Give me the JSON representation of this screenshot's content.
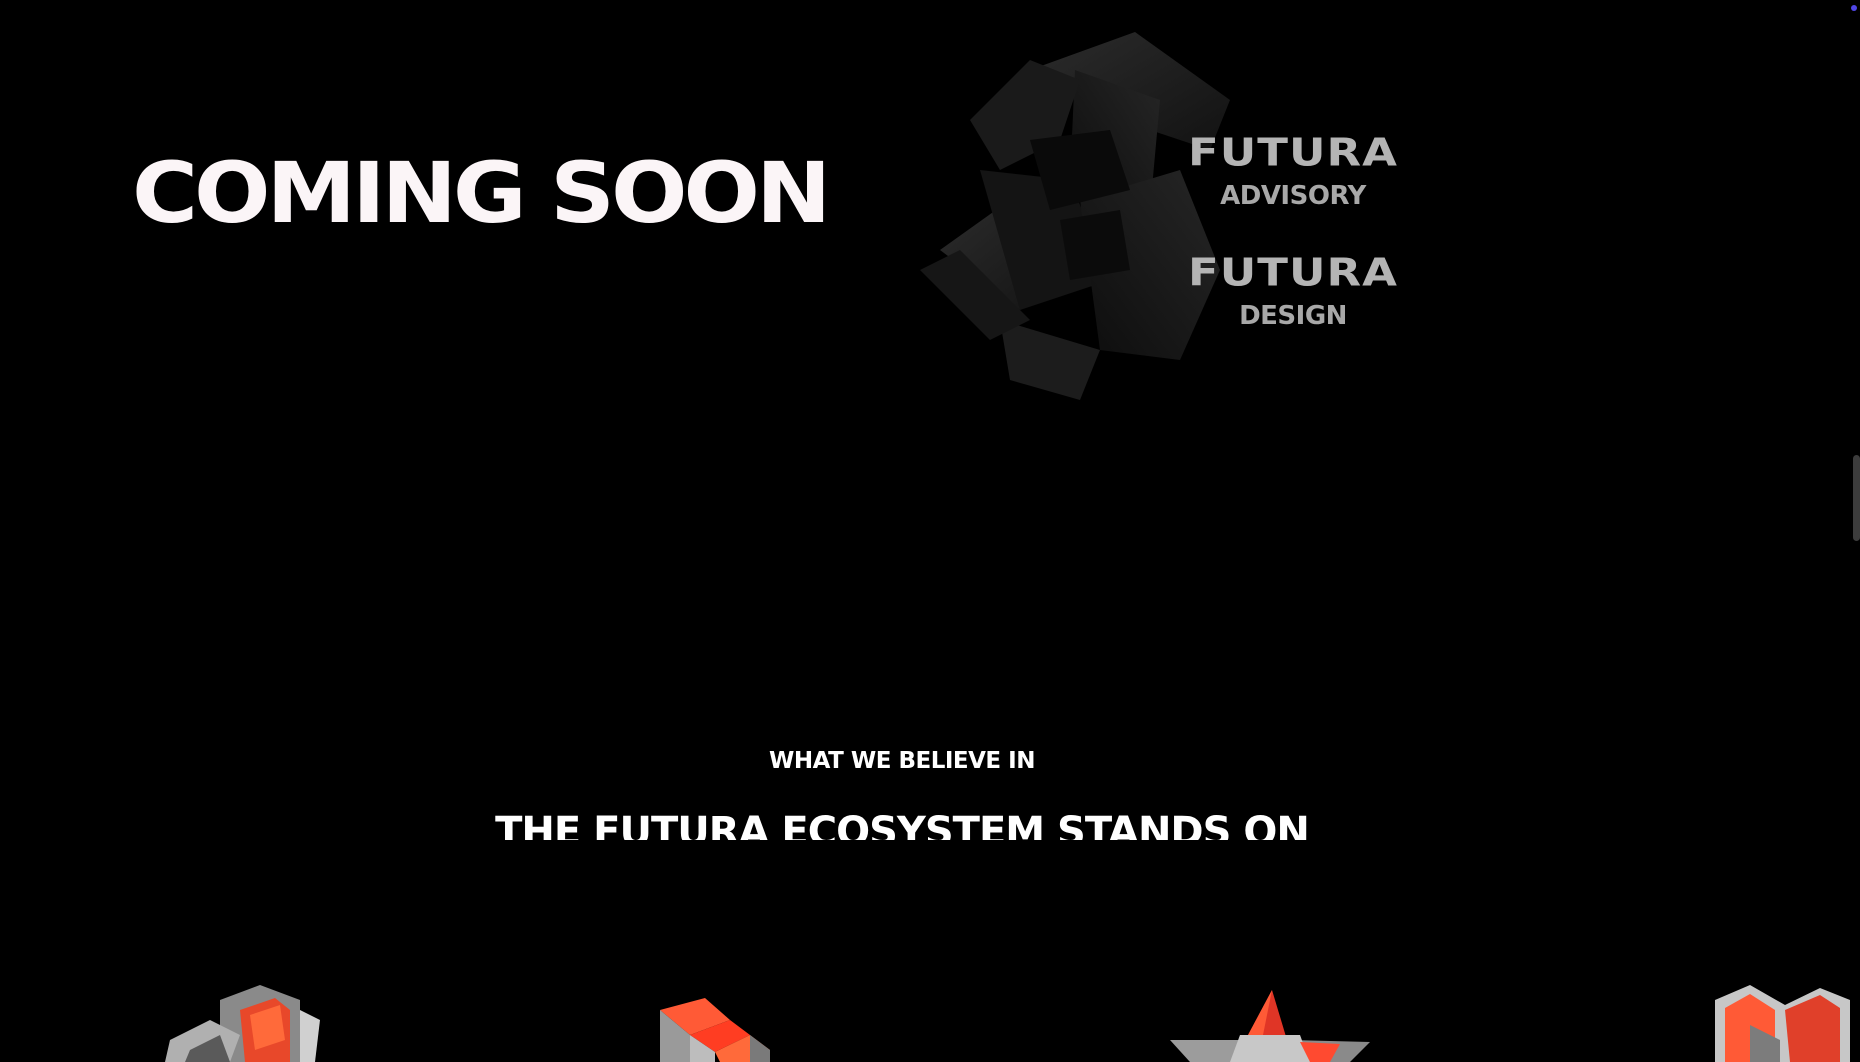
{
  "hero": {
    "title": "COMING SOON"
  },
  "brands": [
    {
      "name": "FUTURA",
      "division": "ADVISORY"
    },
    {
      "name": "FUTURA",
      "division": "DESIGN"
    }
  ],
  "beliefs": {
    "eyebrow": "WHAT WE BELIEVE IN",
    "headline": "THE FUTURA ECOSYSTEM STANDS ON"
  },
  "colors": {
    "background": "#000000",
    "accent": "#ff5a36",
    "text": "#ffffff",
    "muted": "#b4b4b4"
  },
  "icons": {
    "hero_art": "futura-3d-logo-icon",
    "pillars": [
      "cube-cluster-icon",
      "stacked-blocks-icon",
      "star-icon",
      "m-shape-icon"
    ]
  }
}
